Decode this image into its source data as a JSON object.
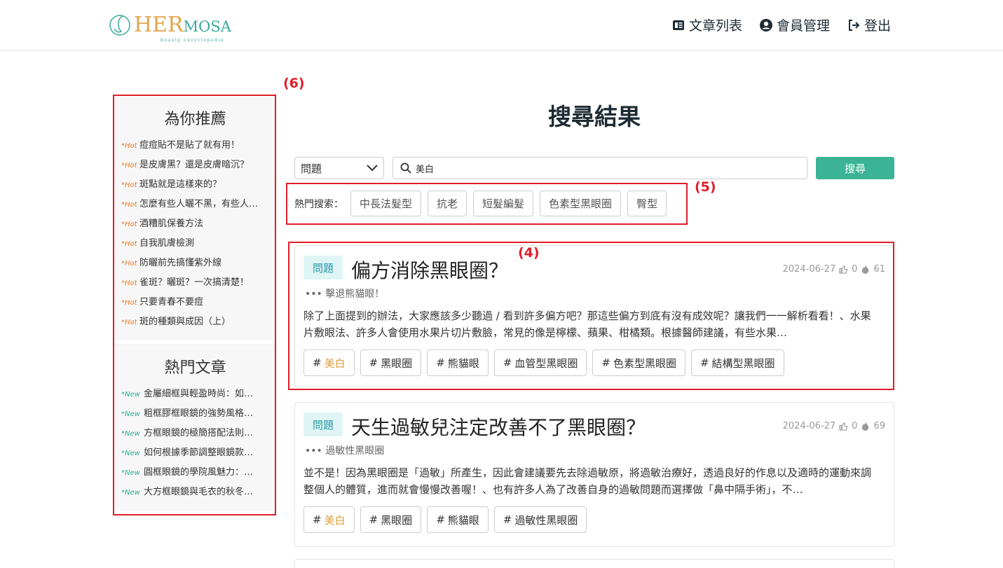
{
  "header": {
    "logo_text_big": "HER",
    "logo_text_small": "MOSA",
    "logo_tagline": "beauty encyclopedia",
    "nav": [
      {
        "label": "文章列表",
        "icon": "article-list-icon"
      },
      {
        "label": "會員管理",
        "icon": "user-circle-icon"
      },
      {
        "label": "登出",
        "icon": "logout-icon"
      }
    ]
  },
  "sidebar": {
    "recommend_title": "為你推薦",
    "recommend_tag": "*Hot",
    "recommend": [
      "痘痘貼不是貼了就有用！",
      "是皮膚黑？還是皮膚暗沉？",
      "斑點就是這樣來的？",
      "怎麼有些人曬不黑，有些人…",
      "酒糟肌保養方法",
      "自我肌膚檢測",
      "防曬前先搞懂紫外線",
      "雀斑？曬斑？一次搞清楚！",
      "只要青春不要痘",
      "斑的種類與成因（上）"
    ],
    "popular_title": "熱門文章",
    "popular_tag": "*New",
    "popular": [
      "金屬細框與輕盈時尚：如…",
      "粗框膠框眼鏡的強勢風格…",
      "方框眼鏡的極簡搭配法則…",
      "如何根據季節調整眼鏡款…",
      "圓框眼鏡的學院風魅力：…",
      "大方框眼鏡與毛衣的秋冬…"
    ]
  },
  "annotations": {
    "a4": "(4)",
    "a5": "(5)",
    "a6": "(6)"
  },
  "main": {
    "title": "搜尋結果",
    "select_value": "問題",
    "search_value": "美白",
    "search_button": "搜尋",
    "hot_label": "熱門搜索：",
    "hot_chips": [
      "中長法髮型",
      "抗老",
      "短髮編髮",
      "色素型黑眼圈",
      "臀型"
    ]
  },
  "cards": [
    {
      "type": "問題",
      "title": "偏方消除黑眼圈？",
      "date": "2024-06-27",
      "likes": "0",
      "views": "61",
      "subtitle": "擊退熊貓眼！",
      "excerpt": "除了上面提到的辦法，大家應該多少聽過 / 看到許多偏方吧？那這些偏方到底有沒有成效呢？讓我們一一解析看看！、水果片敷眼法、許多人會使用水果片切片敷臉，常見的像是檸檬、蘋果、柑橘類。根據醫師建議，有些水果…",
      "tags": [
        "美白",
        "黑眼圈",
        "熊貓眼",
        "血管型黑眼圈",
        "色素型黑眼圈",
        "結構型黑眼圈"
      ]
    },
    {
      "type": "問題",
      "title": "天生過敏兒注定改善不了黑眼圈？",
      "date": "2024-06-27",
      "likes": "0",
      "views": "69",
      "subtitle": "過敏性黑眼圈",
      "excerpt": "並不是！因為黑眼圈是「過敏」所產生，因此會建議要先去除過敏原，將過敏治療好，透過良好的作息以及適時的運動來調整個人的體質，進而就會慢慢改善喔！、也有許多人為了改善自身的過敏問題而選擇做「鼻中隔手術」，不…",
      "tags": [
        "美白",
        "黑眼圈",
        "熊貓眼",
        "過敏性黑眼圈"
      ]
    }
  ],
  "colors": {
    "accent": "#3bb395",
    "annotation": "#e11d2a",
    "hot": "#e67a2b",
    "new": "#2eaa8f",
    "active_tag": "#e0a03a"
  }
}
